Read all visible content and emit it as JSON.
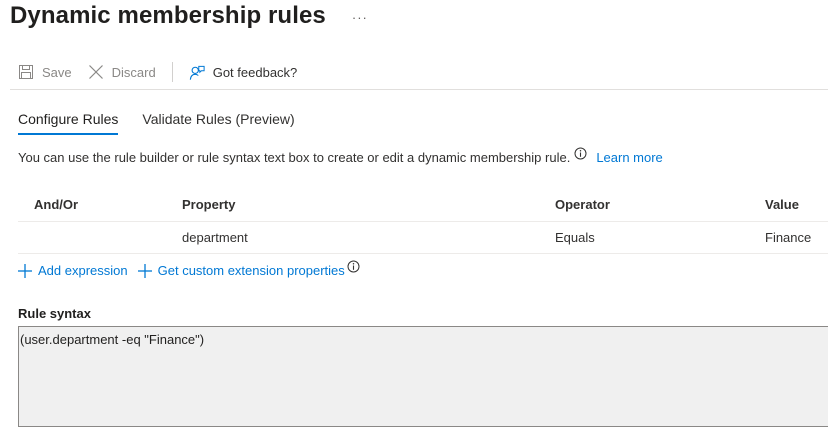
{
  "header": {
    "title": "Dynamic membership rules",
    "more_label": "···"
  },
  "toolbar": {
    "save_label": "Save",
    "discard_label": "Discard",
    "feedback_label": "Got feedback?"
  },
  "tabs": [
    {
      "label": "Configure Rules",
      "active": true
    },
    {
      "label": "Validate Rules (Preview)",
      "active": false
    }
  ],
  "description": {
    "text": "You can use the rule builder or rule syntax text box to create or edit a dynamic membership rule.",
    "link": "Learn more"
  },
  "rules_table": {
    "columns": [
      "And/Or",
      "Property",
      "Operator",
      "Value"
    ],
    "rows": [
      {
        "and_or": "",
        "property": "department",
        "operator": "Equals",
        "value": "Finance"
      }
    ]
  },
  "actions": {
    "add_expression": "Add expression",
    "custom_extension": "Get custom extension properties"
  },
  "syntax": {
    "label": "Rule syntax",
    "value": "(user.department -eq \"Finance\")"
  },
  "colors": {
    "accent": "#0078d4",
    "text": "#323130",
    "disabled": "#8a8886",
    "syntax_bg": "#f0f0f0"
  }
}
